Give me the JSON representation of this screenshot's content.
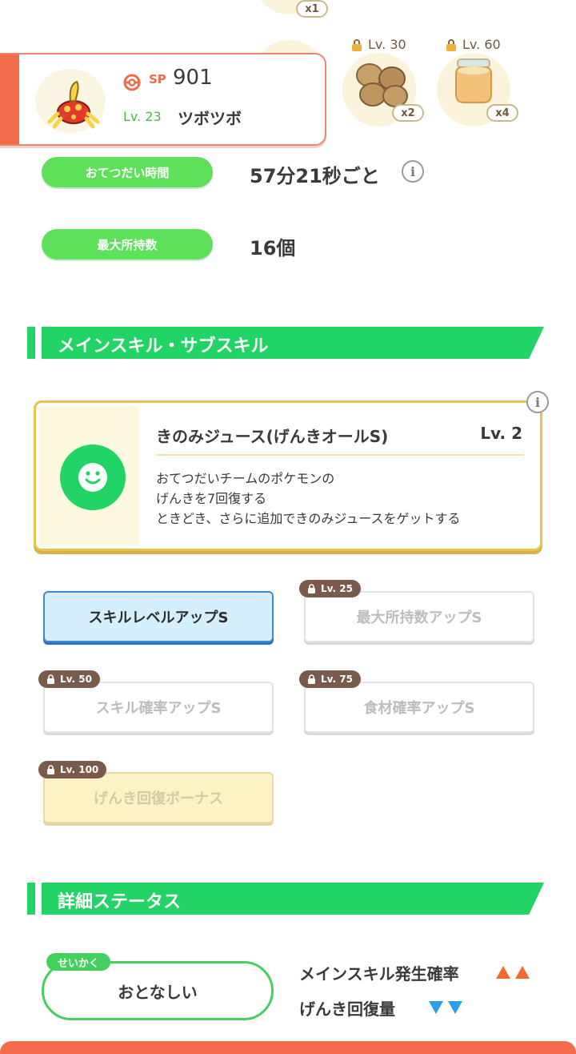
{
  "top_items": {
    "first_qty": "x1",
    "item_lv30": {
      "level": "Lv. 30",
      "qty": "x2"
    },
    "item_lv60": {
      "level": "Lv. 60",
      "qty": "x4"
    }
  },
  "pokemon": {
    "sp_label": "SP",
    "sp_value": "901",
    "level": "Lv. 23",
    "name": "ツボツボ"
  },
  "stats": {
    "help_time_label": "おてつだい時間",
    "help_time_value": "57分21秒ごと",
    "max_carry_label": "最大所持数",
    "max_carry_value": "16個"
  },
  "skills_section": {
    "title": "メインスキル・サブスキル",
    "main_skill": {
      "name": "きのみジュース(げんきオールS)",
      "level": "Lv. 2",
      "desc": [
        "おてつだいチームのポケモンの",
        "げんきを7回復する",
        "ときどき、さらに追加できのみジュースをゲットする"
      ]
    },
    "subskills": [
      {
        "label": "スキルレベルアップS",
        "lock": ""
      },
      {
        "label": "最大所持数アップS",
        "lock": "Lv. 25"
      },
      {
        "label": "スキル確率アップS",
        "lock": "Lv. 50"
      },
      {
        "label": "食材確率アップS",
        "lock": "Lv. 75"
      },
      {
        "label": "げんき回復ボーナス",
        "lock": "Lv. 100"
      }
    ]
  },
  "details_section": {
    "title": "詳細ステータス",
    "nature_tag": "せいかく",
    "nature": "おとなしい",
    "up_effect": "メインスキル発生確率",
    "down_effect": "げんき回復量"
  },
  "colors": {
    "accent_green": "#22d365",
    "pill_green": "#5fe05a",
    "card_accent": "#f26b4b",
    "up_arrow": "#f26a2e",
    "down_arrow": "#2aa0e8"
  }
}
